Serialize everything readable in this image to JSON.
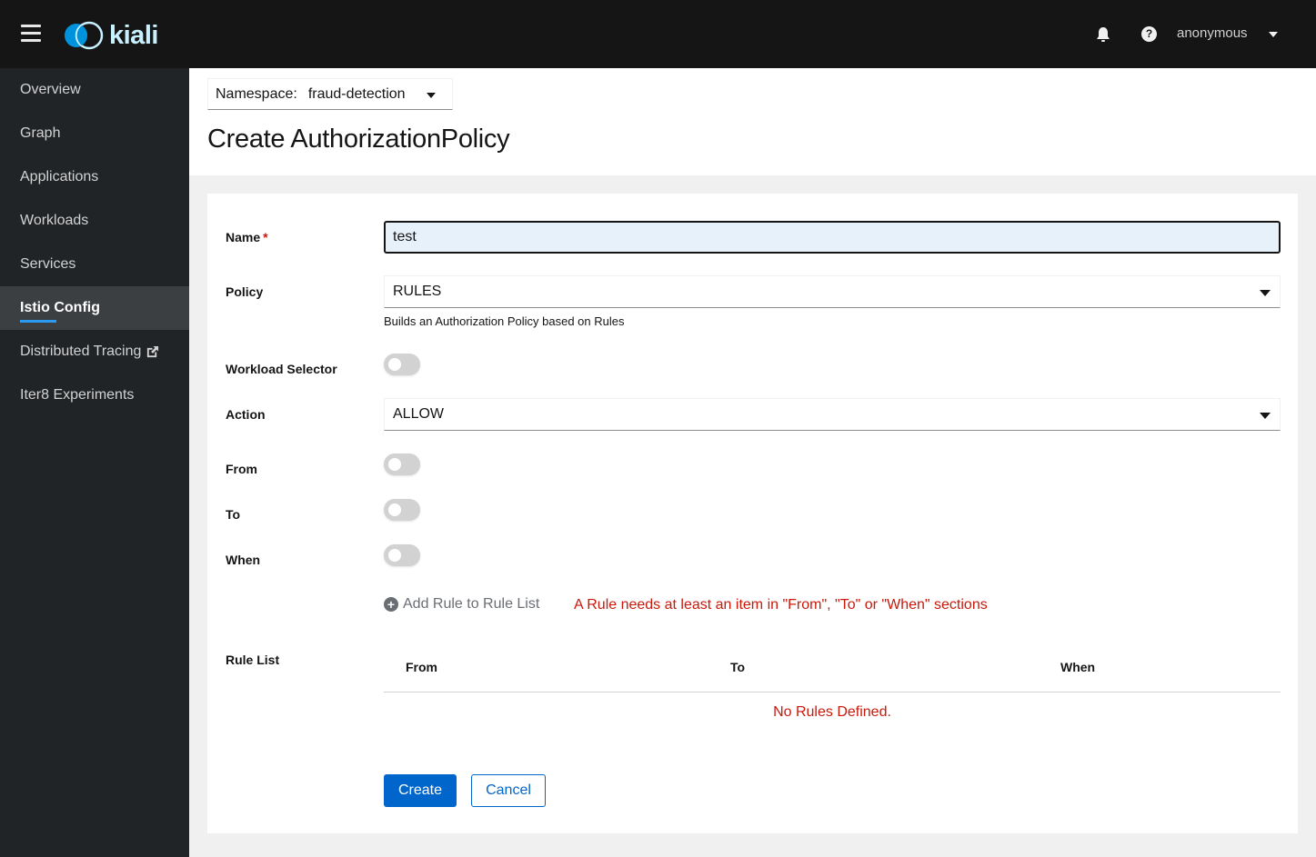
{
  "header": {
    "brand": "kiali",
    "user": "anonymous"
  },
  "sidebar": {
    "items": [
      {
        "label": "Overview",
        "active": false
      },
      {
        "label": "Graph",
        "active": false
      },
      {
        "label": "Applications",
        "active": false
      },
      {
        "label": "Workloads",
        "active": false
      },
      {
        "label": "Services",
        "active": false
      },
      {
        "label": "Istio Config",
        "active": true
      },
      {
        "label": "Distributed Tracing",
        "active": false,
        "external": true
      },
      {
        "label": "Iter8 Experiments",
        "active": false
      }
    ]
  },
  "namespace": {
    "label": "Namespace:",
    "value": "fraud-detection"
  },
  "page": {
    "title": "Create AuthorizationPolicy"
  },
  "form": {
    "name": {
      "label": "Name",
      "required_mark": "*",
      "value": "test"
    },
    "policy": {
      "label": "Policy",
      "value": "RULES",
      "helper": "Builds an Authorization Policy based on Rules"
    },
    "workload_selector": {
      "label": "Workload Selector",
      "on": false
    },
    "action": {
      "label": "Action",
      "value": "ALLOW"
    },
    "from": {
      "label": "From",
      "on": false
    },
    "to": {
      "label": "To",
      "on": false
    },
    "when": {
      "label": "When",
      "on": false
    },
    "add_rule": "Add Rule to Rule List",
    "rule_error": "A Rule needs at least an item in \"From\", \"To\" or \"When\" sections",
    "rule_list": {
      "label": "Rule List",
      "columns": [
        "From",
        "To",
        "When"
      ],
      "empty": "No Rules Defined."
    },
    "create_label": "Create",
    "cancel_label": "Cancel"
  },
  "colors": {
    "primary": "#0066cc",
    "error": "#c9190b",
    "nav_active_indicator": "#2b9af3",
    "masthead": "#151515",
    "sidebar": "#212427"
  }
}
